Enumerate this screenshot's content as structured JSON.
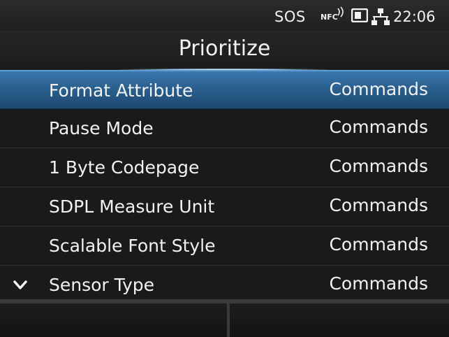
{
  "status": {
    "sos": "SOS",
    "nfc": "NFC",
    "time": "22:06"
  },
  "header": {
    "title": "Prioritize"
  },
  "list": {
    "items": [
      {
        "label": "Format Attribute",
        "value": "Commands",
        "selected": true
      },
      {
        "label": "Pause Mode",
        "value": "Commands"
      },
      {
        "label": "1 Byte Codepage",
        "value": "Commands"
      },
      {
        "label": "SDPL Measure Unit",
        "value": "Commands"
      },
      {
        "label": "Scalable Font Style",
        "value": "Commands"
      },
      {
        "label": "Sensor Type",
        "value": "Commands"
      }
    ]
  },
  "colors": {
    "selected_row": "#2a5f8d",
    "background": "#1a1a1a"
  }
}
